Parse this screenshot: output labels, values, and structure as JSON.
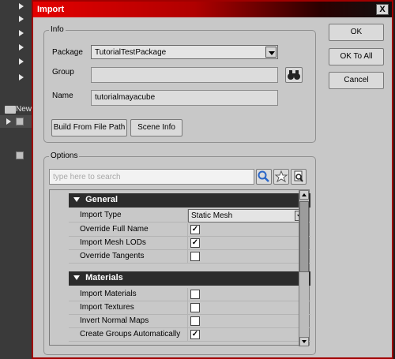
{
  "background": {
    "folder_label": "New"
  },
  "window": {
    "title": "Import",
    "close_glyph": "X"
  },
  "info": {
    "legend": "Info",
    "package_label": "Package",
    "package_value": "TutorialTestPackage",
    "group_label": "Group",
    "group_value": "",
    "name_label": "Name",
    "name_value": "tutorialmayacube",
    "build_button": "Build From File Path",
    "scene_info_button": "Scene Info"
  },
  "actions": {
    "ok": "OK",
    "ok_to_all": "OK To All",
    "cancel": "Cancel"
  },
  "options": {
    "legend": "Options",
    "search_placeholder": "type here to search",
    "categories": [
      {
        "title": "General",
        "rows": [
          {
            "name": "Import Type",
            "value": "Static Mesh"
          },
          {
            "name": "Override Full Name",
            "checked": true
          },
          {
            "name": "Import Mesh LODs",
            "checked": true
          },
          {
            "name": "Override Tangents",
            "checked": false
          }
        ]
      },
      {
        "title": "Materials",
        "rows": [
          {
            "name": "Import Materials",
            "checked": false
          },
          {
            "name": "Import Textures",
            "checked": false
          },
          {
            "name": "Invert Normal Maps",
            "checked": false
          },
          {
            "name": "Create Groups Automatically",
            "checked": true
          }
        ]
      }
    ]
  },
  "colors": {
    "title_red": "#e40000",
    "dialog_bg": "#c8c8c8",
    "category_bg": "#2c2c2c",
    "search_icon_blue": "#2a66c8"
  },
  "icons": [
    "binoculars-icon",
    "search-icon",
    "star-icon",
    "search-doc-icon"
  ],
  "check_glyph": "✓"
}
